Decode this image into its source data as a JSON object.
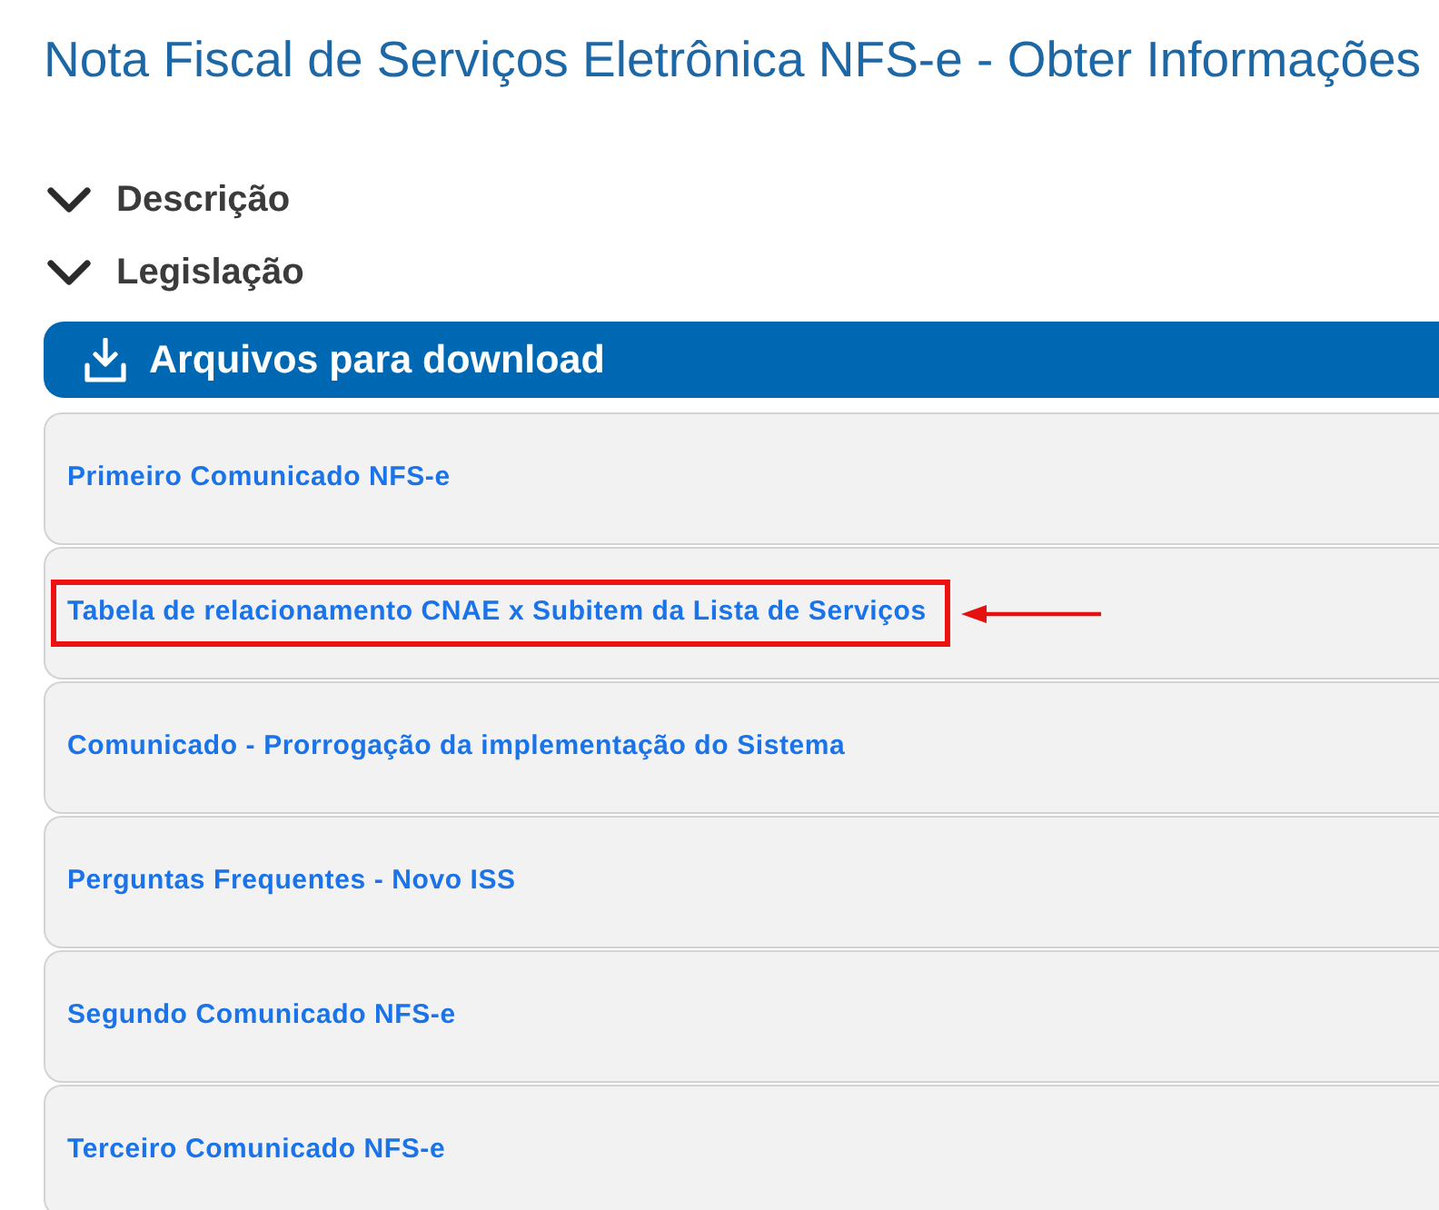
{
  "title": "Nota Fiscal de Serviços Eletrônica NFS-e - Obter Informações",
  "sections": [
    {
      "label": "Descrição",
      "expanded": false
    },
    {
      "label": "Legislação",
      "expanded": false
    }
  ],
  "downloads": {
    "heading": "Arquivos para download",
    "items": [
      {
        "label": "Primeiro Comunicado NFS-e",
        "highlighted": false
      },
      {
        "label": "Tabela de relacionamento CNAE x Subitem da Lista de Serviços",
        "highlighted": true
      },
      {
        "label": "Comunicado - Prorrogação da implementação do Sistema",
        "highlighted": false
      },
      {
        "label": "Perguntas Frequentes - Novo ISS",
        "highlighted": false
      },
      {
        "label": "Segundo Comunicado NFS-e",
        "highlighted": false
      },
      {
        "label": "Terceiro Comunicado NFS-e",
        "highlighted": false
      }
    ]
  }
}
